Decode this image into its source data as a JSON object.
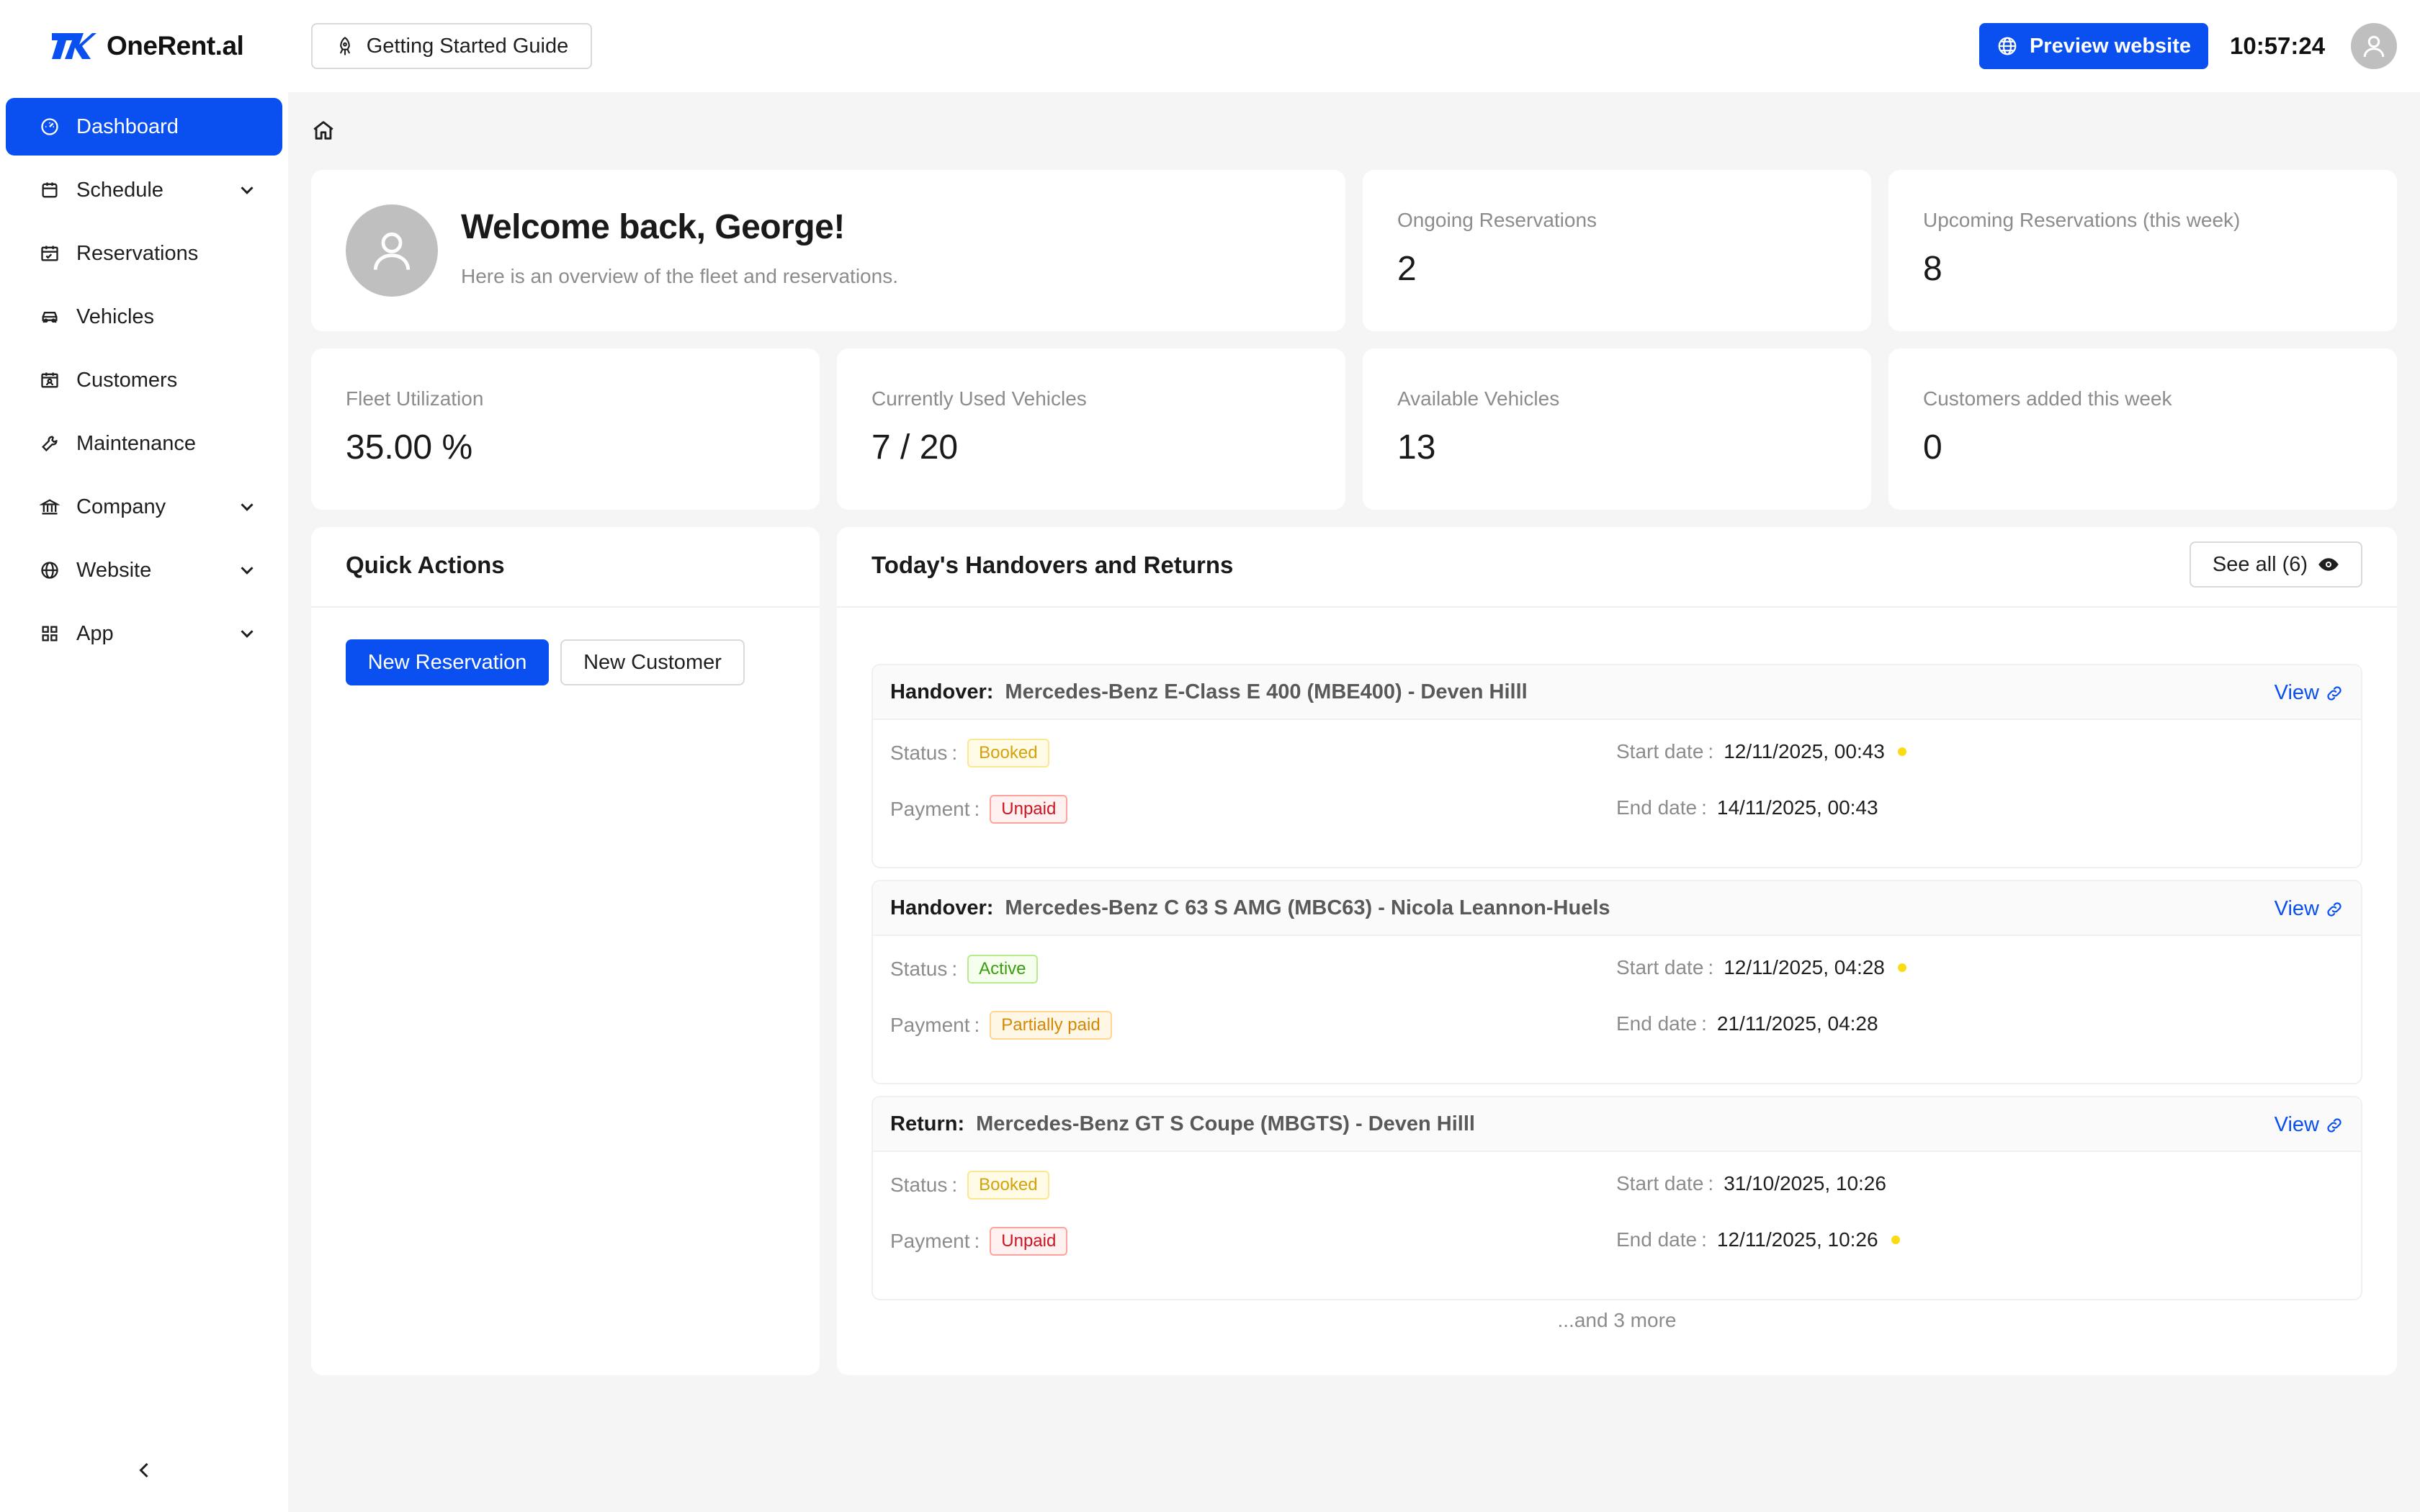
{
  "header": {
    "brand": "OneRent.al",
    "guide_label": "Getting Started Guide",
    "preview_label": "Preview website",
    "clock": "10:57:24",
    "accent": "#0a50f0"
  },
  "sidebar": {
    "items": [
      {
        "label": "Dashboard",
        "icon": "dashboard-icon",
        "active": true
      },
      {
        "label": "Schedule",
        "icon": "calendar-icon",
        "has_children": true
      },
      {
        "label": "Reservations",
        "icon": "calendar-check-icon"
      },
      {
        "label": "Vehicles",
        "icon": "car-icon"
      },
      {
        "label": "Customers",
        "icon": "id-card-icon"
      },
      {
        "label": "Maintenance",
        "icon": "wrench-icon"
      },
      {
        "label": "Company",
        "icon": "bank-icon",
        "has_children": true
      },
      {
        "label": "Website",
        "icon": "globe-icon",
        "has_children": true
      },
      {
        "label": "App",
        "icon": "apps-grid-icon",
        "has_children": true
      }
    ]
  },
  "welcome": {
    "title": "Welcome back, George!",
    "subtitle": "Here is an overview of the fleet and reservations."
  },
  "stats": {
    "ongoing": {
      "label": "Ongoing Reservations",
      "value": "2"
    },
    "upcoming": {
      "label": "Upcoming Reservations (this week)",
      "value": "8"
    },
    "utilization": {
      "label": "Fleet Utilization",
      "value": "35.00 %"
    },
    "used": {
      "label": "Currently Used Vehicles",
      "value": "7 / 20"
    },
    "available": {
      "label": "Available Vehicles",
      "value": "13"
    },
    "customers_added": {
      "label": "Customers added this week",
      "value": "0"
    }
  },
  "quick_actions": {
    "title": "Quick Actions",
    "new_reservation": "New Reservation",
    "new_customer": "New Customer"
  },
  "handovers": {
    "title": "Today's Handovers and Returns",
    "see_all": "See all (6)",
    "view_label": "View",
    "status_label": "Status",
    "payment_label": "Payment",
    "start_label": "Start date",
    "end_label": "End date",
    "colon": ":",
    "more": "...and 3 more",
    "items": [
      {
        "kind": "Handover:",
        "vehicle": "Mercedes-Benz E-Class E 400 (MBE400) - Deven Hilll",
        "status": "Booked",
        "payment": "Unpaid",
        "start": "12/11/2025, 00:43",
        "end": "14/11/2025, 00:43"
      },
      {
        "kind": "Handover:",
        "vehicle": "Mercedes-Benz C 63 S AMG (MBC63) - Nicola Leannon-Huels",
        "status": "Active",
        "payment": "Partially paid",
        "start": "12/11/2025, 04:28",
        "end": "21/11/2025, 04:28"
      },
      {
        "kind": "Return:",
        "vehicle": "Mercedes-Benz GT S Coupe (MBGTS) - Deven Hilll",
        "status": "Booked",
        "payment": "Unpaid",
        "start": "31/10/2025, 10:26",
        "end": "12/11/2025, 10:26"
      }
    ]
  }
}
